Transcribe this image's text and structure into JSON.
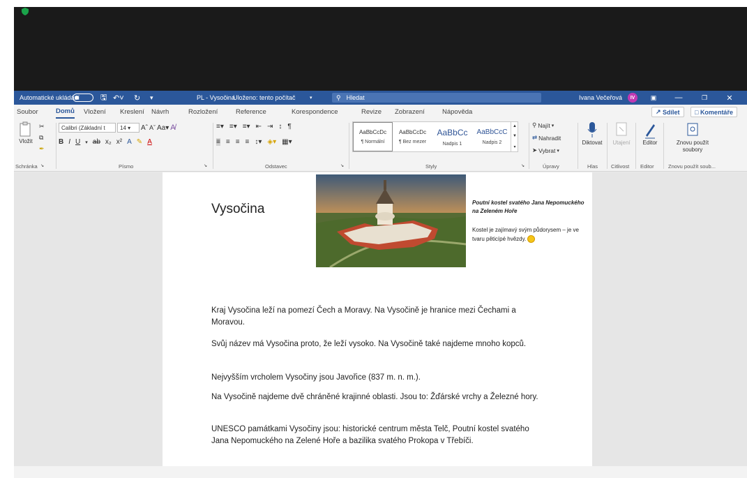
{
  "titlebar": {
    "autosave_label": "Automatické ukládání",
    "doc_title": "PL - Vysočina",
    "save_status": "Uloženo: tento počítač",
    "search_placeholder": "Hledat",
    "user_name": "Ivana Večeřová",
    "user_initials": "IV"
  },
  "menu": {
    "tabs": [
      "Soubor",
      "Domů",
      "Vložení",
      "Kreslení",
      "Návrh",
      "Rozložení",
      "Reference",
      "Korespondence",
      "Revize",
      "Zobrazení",
      "Nápověda"
    ],
    "share_label": "Sdílet",
    "comments_label": "Komentáře"
  },
  "ribbon": {
    "paste_label": "Vložit",
    "font_name": "Calibri (Základní t",
    "font_size": "14",
    "styles": [
      {
        "sample": "AaBbCcDc",
        "name": "¶ Normální"
      },
      {
        "sample": "AaBbCcDc",
        "name": "¶ Bez mezer"
      },
      {
        "sample": "AaBbCc",
        "name": "Nadpis 1"
      },
      {
        "sample": "AaBbCcC",
        "name": "Nadpis 2"
      }
    ],
    "find_label": "Najít",
    "replace_label": "Nahradit",
    "select_label": "Vybrat",
    "dictate_label": "Diktovat",
    "sensitivity_label": "Utajení",
    "editor_label": "Editor",
    "reuse_label": "Znovu použít soubory",
    "groups": {
      "clipboard": "Schránka",
      "font": "Písmo",
      "paragraph": "Odstavec",
      "styles": "Styly",
      "editing": "Úpravy",
      "voice": "Hlas",
      "sensitivity": "Citlivost",
      "editor": "Editor",
      "reuse": "Znovu použít soub..."
    }
  },
  "document": {
    "title": "Vysočina",
    "caption_title": "Poutní kostel svatého Jana Nepomuckého na Zeleném Hoře",
    "caption_body": "Kostel je zajímavý svým půdorysem – je ve tvaru pěticípé hvězdy.",
    "paragraphs": [
      "Kraj Vysočina leží na pomezí Čech a Moravy. Na Vysočině je hranice mezi Čechami a Moravou.",
      "Svůj název má Vysočina proto, že leží vysoko. Na Vysočině také najdeme mnoho kopců.",
      "Nejvyšším vrcholem Vysočiny jsou Javořice (837 m. n. m.).",
      "Na Vysočině najdeme dvě chráněné krajinné oblasti. Jsou to: Žďárské vrchy a Železné hory.",
      "UNESCO památkami Vysočiny jsou: historické centrum města Telč, Poutní kostel svatého Jana Nepomuckého na Zelené Hoře a bazilika svatého Prokopa v Třebíči."
    ]
  },
  "colors": {
    "word_blue": "#2b579a",
    "avatar": "#c239b3",
    "shield_green": "#1aa34a"
  }
}
